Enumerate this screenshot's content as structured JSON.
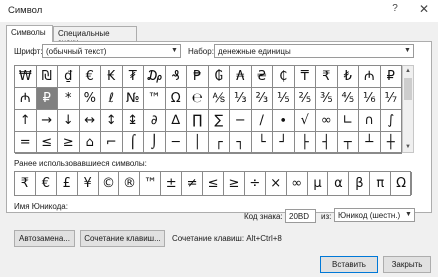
{
  "window": {
    "title": "Символ",
    "help": "?",
    "close": "✕"
  },
  "tabs": [
    {
      "label": "Символы"
    },
    {
      "label": "Специальные знаки"
    }
  ],
  "font": {
    "label": "Шрифт:",
    "value": "(обычный текст)"
  },
  "subset": {
    "label": "Набор:",
    "value": "денежные единицы"
  },
  "grid": {
    "rows": [
      [
        "₩",
        "₪",
        "₫",
        "€",
        "₭",
        "₮",
        "₯",
        "₰",
        "₱",
        "₲",
        "₳",
        "₴",
        "₵",
        "₸",
        "₹",
        "₺",
        "₼",
        "₽"
      ],
      [
        "₼",
        "₽",
        "*",
        "%",
        "ℓ",
        "№",
        "™",
        "Ω",
        "℮",
        "⅍",
        "⅓",
        "⅔",
        "⅕",
        "⅖",
        "⅗",
        "⅘",
        "⅙",
        "⅐"
      ],
      [
        "↑",
        "→",
        "↓",
        "↔",
        "↕",
        "↨",
        "∂",
        "∆",
        "∏",
        "∑",
        "−",
        "∕",
        "∙",
        "√",
        "∞",
        "∟",
        "∩",
        "∫"
      ],
      [
        "=",
        "≤",
        "≥",
        "⌂",
        "⌐",
        "⌠",
        "⌡",
        "─",
        "│",
        "┌",
        "┐",
        "└",
        "┘",
        "├",
        "┤",
        "┬",
        "┴",
        "┼"
      ]
    ],
    "selected_row": 1,
    "selected_col": 1
  },
  "recent": {
    "label": "Ранее использовавшиеся символы:",
    "symbols": [
      "₹",
      "€",
      "£",
      "¥",
      "©",
      "®",
      "™",
      "±",
      "≠",
      "≤",
      "≥",
      "÷",
      "×",
      "∞",
      "µ",
      "α",
      "β",
      "π",
      "Ω"
    ]
  },
  "unicode_name": {
    "label": "Имя Юникода:"
  },
  "code": {
    "label": "Код знака:",
    "value": "20BD",
    "from_label": "из:",
    "from_value": "Юникод (шестн.)"
  },
  "buttons": {
    "autocorrect": "Автозамена...",
    "shortcut": "Сочетание клавиш...",
    "insert": "Вставить",
    "cancel": "Закрыть"
  },
  "shortcut_text": "Сочетание клавиш: Alt+Ctrl+8"
}
